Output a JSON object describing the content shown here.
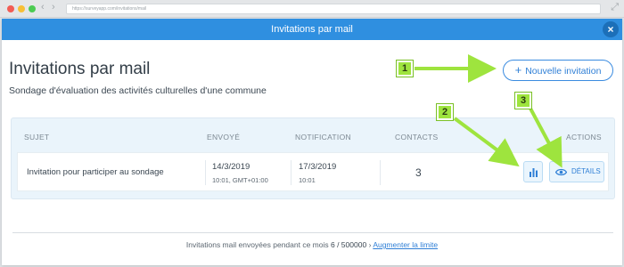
{
  "browser": {
    "url": "https://surveyapp.com/invitations/mail"
  },
  "modal": {
    "title": "Invitations par mail"
  },
  "page": {
    "title": "Invitations par mail",
    "subtitle": "Sondage d'évaluation des activités culturelles d'une commune",
    "new_invite_label": "Nouvelle invitation"
  },
  "table": {
    "headers": {
      "subject": "SUJET",
      "sent": "ENVOYÉ",
      "notification": "NOTIFICATION",
      "contacts": "CONTACTS",
      "actions": "ACTIONS"
    },
    "rows": [
      {
        "subject": "Invitation pour participer au sondage",
        "sent_date": "14/3/2019",
        "sent_time": "10:01, GMT+01:00",
        "notif_date": "17/3/2019",
        "notif_time": "10:01",
        "contacts": "3",
        "details_label": "DÉTAILS"
      }
    ]
  },
  "footer": {
    "text": "Invitations mail envoyées pendant ce mois",
    "count": "6 / 500000",
    "link_label": "Augmenter la limite"
  },
  "callouts": [
    "1",
    "2",
    "3"
  ],
  "colors": {
    "header_blue": "#2f8fe0",
    "accent_blue": "#2f7fd6",
    "callout_green": "#9ee43e"
  }
}
